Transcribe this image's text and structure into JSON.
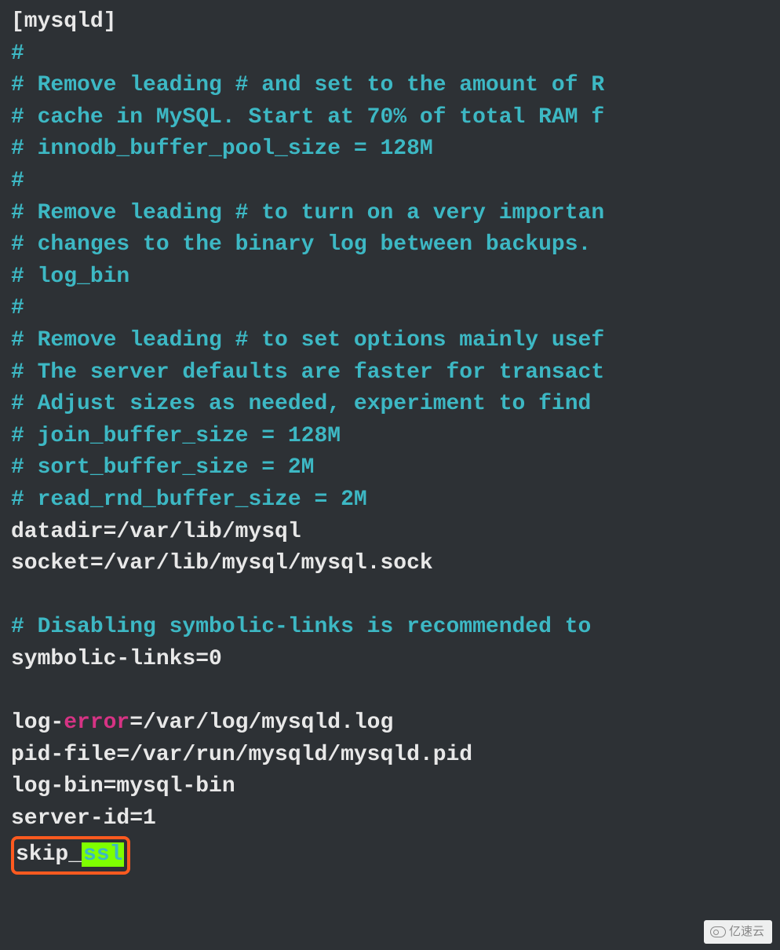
{
  "lines": [
    {
      "cls": "section",
      "text": "[mysqld]"
    },
    {
      "cls": "comment",
      "text": "#"
    },
    {
      "cls": "comment",
      "text": "# Remove leading # and set to the amount of R"
    },
    {
      "cls": "comment",
      "text": "# cache in MySQL. Start at 70% of total RAM f"
    },
    {
      "cls": "comment",
      "text": "# innodb_buffer_pool_size = 128M"
    },
    {
      "cls": "comment",
      "text": "#"
    },
    {
      "cls": "comment",
      "text": "# Remove leading # to turn on a very importan"
    },
    {
      "cls": "comment",
      "text": "# changes to the binary log between backups."
    },
    {
      "cls": "comment",
      "text": "# log_bin"
    },
    {
      "cls": "comment",
      "text": "#"
    },
    {
      "cls": "comment",
      "text": "# Remove leading # to set options mainly usef"
    },
    {
      "cls": "comment",
      "text": "# The server defaults are faster for transact"
    },
    {
      "cls": "comment",
      "text": "# Adjust sizes as needed, experiment to find "
    },
    {
      "cls": "comment",
      "text": "# join_buffer_size = 128M"
    },
    {
      "cls": "comment",
      "text": "# sort_buffer_size = 2M"
    },
    {
      "cls": "comment",
      "text": "# read_rnd_buffer_size = 2M"
    },
    {
      "cls": "plain",
      "text": "datadir=/var/lib/mysql"
    },
    {
      "cls": "plain",
      "text": "socket=/var/lib/mysql/mysql.sock"
    },
    {
      "cls": "plain",
      "text": ""
    },
    {
      "cls": "comment",
      "text": "# Disabling symbolic-links is recommended to "
    },
    {
      "cls": "plain",
      "text": "symbolic-links=0"
    },
    {
      "cls": "plain",
      "text": ""
    }
  ],
  "logerror": {
    "prefix": "log-",
    "word": "error",
    "suffix": "=/var/log/mysqld.log"
  },
  "tail": [
    {
      "cls": "plain",
      "text": "pid-file=/var/run/mysqld/mysqld.pid"
    },
    {
      "cls": "plain",
      "text": "log-bin=mysql-bin"
    },
    {
      "cls": "plain",
      "text": "server-id=1"
    }
  ],
  "skip": {
    "prefix": "skip_",
    "hl": "ssl"
  },
  "watermark": "亿速云"
}
